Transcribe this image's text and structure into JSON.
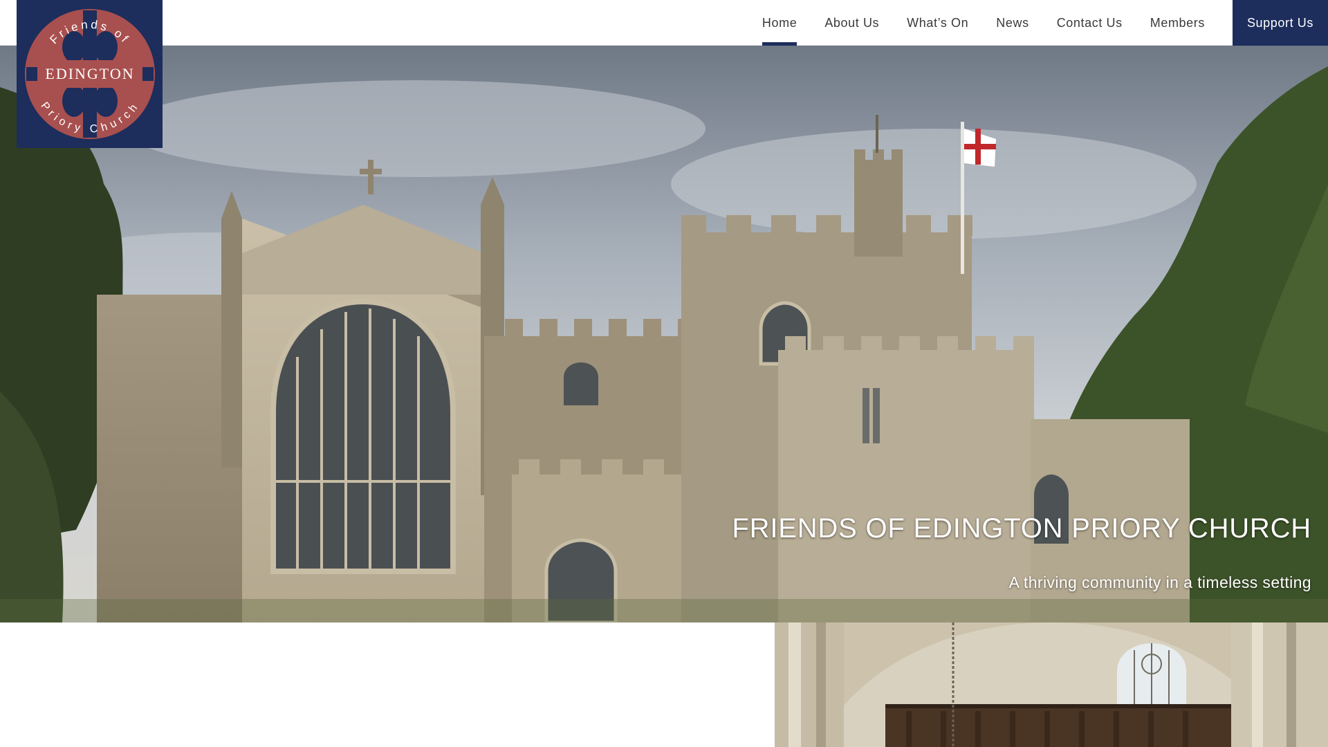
{
  "site": {
    "logo": {
      "top_text": "Friends of",
      "middle_text": "EDINGTON",
      "bottom_text": "Priory Church"
    }
  },
  "nav": {
    "items": [
      {
        "label": "Home",
        "active": true
      },
      {
        "label": "About Us",
        "active": false
      },
      {
        "label": "What’s On",
        "active": false
      },
      {
        "label": "News",
        "active": false
      },
      {
        "label": "Contact Us",
        "active": false
      },
      {
        "label": "Members",
        "active": false
      }
    ],
    "cta_label": "Support Us"
  },
  "hero": {
    "title": "FRIENDS OF EDINGTON PRIORY CHURCH",
    "subtitle": "A thriving community in a timeless setting",
    "image": "priory-church-exterior"
  },
  "interior_image": "priory-church-interior",
  "colors": {
    "brand_navy": "#1d2d5c",
    "logo_red": "#a8504f",
    "text": "#3a3a3a"
  }
}
